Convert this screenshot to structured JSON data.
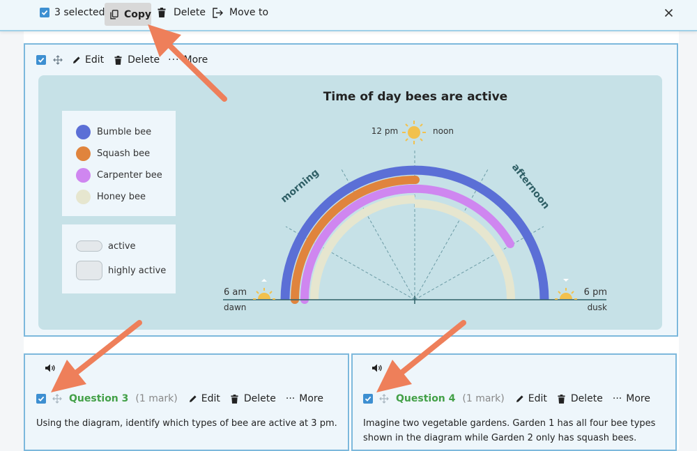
{
  "toolbar": {
    "selected_label": "3 selected",
    "copy_label": "Copy",
    "delete_label": "Delete",
    "move_label": "Move to"
  },
  "diagram_card": {
    "edit_label": "Edit",
    "delete_label": "Delete",
    "more_label": "More"
  },
  "figure": {
    "title": "Time of day bees are active",
    "legend_species": [
      {
        "label": "Bumble bee",
        "color": "#5b6fd6"
      },
      {
        "label": "Squash bee",
        "color": "#e0843d"
      },
      {
        "label": "Carpenter bee",
        "color": "#cf86f0"
      },
      {
        "label": "Honey bee",
        "color": "#e6e6cf"
      }
    ],
    "legend_activity": [
      {
        "label": "active"
      },
      {
        "label": "highly active"
      }
    ],
    "time_labels": {
      "noon_time": "12 pm",
      "noon_word": "noon",
      "left_time": "6 am",
      "left_word": "dawn",
      "right_time": "6 pm",
      "right_word": "dusk",
      "morning": "morning",
      "afternoon": "afternoon"
    }
  },
  "questions": [
    {
      "title": "Question 3",
      "mark": "(1 mark)",
      "edit_label": "Edit",
      "delete_label": "Delete",
      "more_label": "More",
      "text_line1": "Using the diagram, identify which types of bee are active at 3 pm.",
      "text_line2": ""
    },
    {
      "title": "Question 4",
      "mark": "(1 mark)",
      "edit_label": "Edit",
      "delete_label": "Delete",
      "more_label": "More",
      "text_line1": "Imagine two vegetable gardens. Garden 1 has all four bee types",
      "text_line2": "shown in the diagram while Garden 2 only has squash bees."
    }
  ],
  "colors": {
    "accent": "#3d8fd1",
    "question_title": "#43a047",
    "arrow": "#ee7f5a"
  }
}
